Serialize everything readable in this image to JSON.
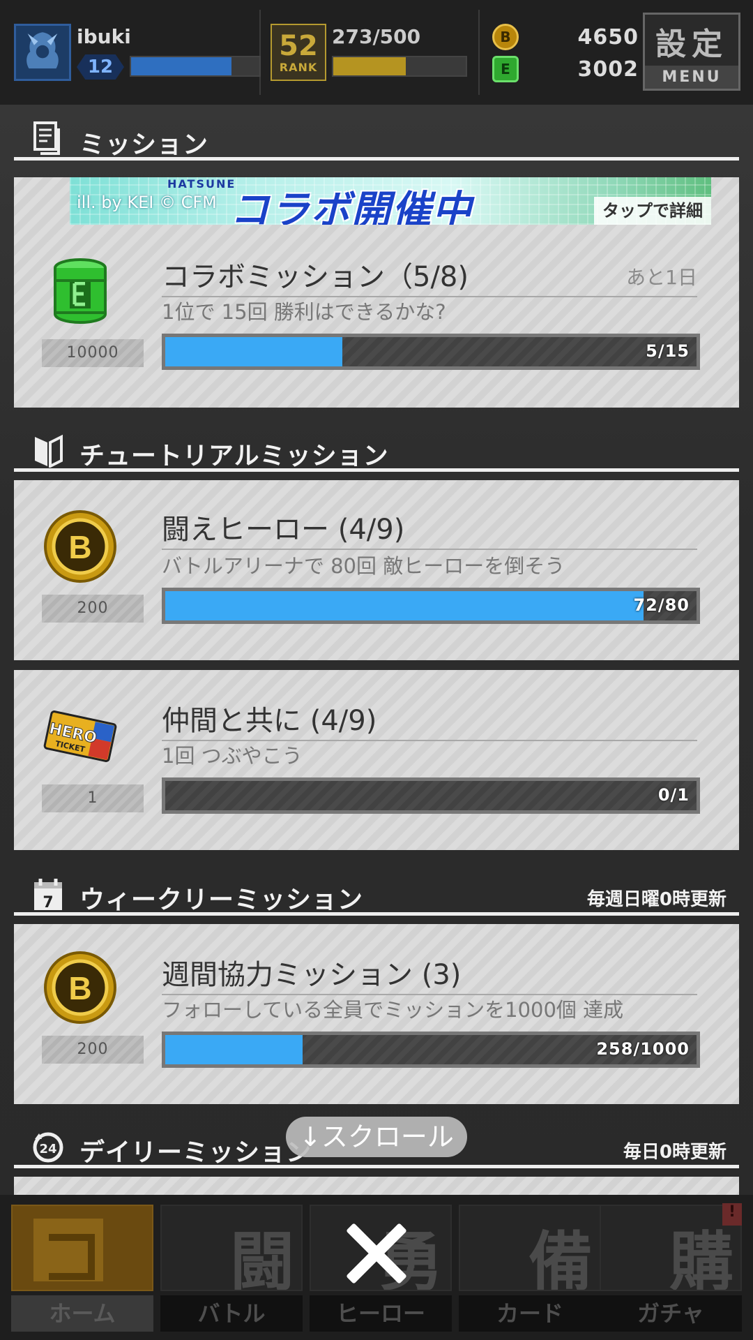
{
  "player": {
    "name": "ibuki",
    "level": "12",
    "exp_ratio": 0.78
  },
  "rank": {
    "number": "52",
    "word": "RANK",
    "exp_text": "273/500",
    "exp_ratio": 0.546
  },
  "currency": {
    "coin_glyph": "B",
    "coin_value": "4650",
    "can_glyph": "E",
    "can_value": "3002"
  },
  "menu": {
    "kanji": "設定",
    "word": "MENU"
  },
  "sections": {
    "mission": {
      "title": "ミッション"
    },
    "tutorial": {
      "title": "チュートリアルミッション"
    },
    "weekly": {
      "title": "ウィークリーミッション",
      "note": "毎週日曜0時更新"
    },
    "daily": {
      "title": "デイリーミッション",
      "note": "毎日0時更新"
    }
  },
  "banner": {
    "credit": "ill. by KEI © CFM",
    "sub": "HATSUNE",
    "title": "コラボ開催中",
    "tap": "タップで詳細"
  },
  "missions": [
    {
      "title": "コラボミッション（5/8)",
      "remain": "あと1日",
      "desc": "1位で 15回 勝利はできるかな?",
      "reward_amount": "10000",
      "reward_icon": "can-icon",
      "progress_text": "5/15",
      "progress": 0.3333
    },
    {
      "title": "闘えヒーロー (4/9)",
      "desc": "バトルアリーナで 80回 敵ヒーローを倒そう",
      "reward_amount": "200",
      "reward_icon": "coin-icon",
      "progress_text": "72/80",
      "progress": 0.9
    },
    {
      "title": "仲間と共に (4/9)",
      "desc": "1回 つぶやこう",
      "reward_amount": "1",
      "reward_icon": "hero-ticket-icon",
      "reward_ticket_text": "HERO TICKET",
      "progress_text": "0/1",
      "progress": 0
    },
    {
      "title": "週間協力ミッション (3)",
      "desc": "フォローしている全員でミッションを1000個 達成",
      "reward_amount": "200",
      "reward_icon": "coin-icon",
      "progress_text": "258/1000",
      "progress": 0.258
    }
  ],
  "scroll_hint": "↓スクロール",
  "nav": [
    {
      "label": "ホーム",
      "kanji": ""
    },
    {
      "label": "バトル",
      "kanji": "闘"
    },
    {
      "label": "ヒーロー",
      "kanji": "勇"
    },
    {
      "label": "カード",
      "kanji": "備"
    },
    {
      "label": "ガチャ",
      "kanji": "購",
      "badge": "!"
    }
  ],
  "colors": {
    "progress_fill": "#3aa9f5",
    "card_bg": "#d8d8d8",
    "rank_gold": "#c9a93a",
    "exp_blue": "#2f6fc0"
  }
}
